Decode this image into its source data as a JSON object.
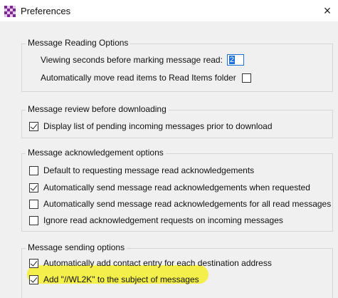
{
  "window": {
    "title": "Preferences",
    "close_glyph": "×"
  },
  "groups": [
    {
      "title": "Message Reading Options",
      "rows": [
        {
          "label": "Viewing seconds before marking message read:",
          "input_value": "2"
        },
        {
          "label": "Automatically move read items to Read Items folder",
          "checked": false
        }
      ]
    },
    {
      "title": "Message review before downloading",
      "rows": [
        {
          "label": "Display list of pending incoming messages prior to download",
          "checked": true
        }
      ]
    },
    {
      "title": "Message acknowledgement options",
      "rows": [
        {
          "label": "Default to requesting message read acknowledgements",
          "checked": false
        },
        {
          "label": "Automatically send message read acknowledgements when requested",
          "checked": true
        },
        {
          "label": "Automatically send message read acknowledgements for all read messages",
          "checked": false
        },
        {
          "label": "Ignore read acknowledgement requests on incoming messages",
          "checked": false
        }
      ]
    },
    {
      "title": "Message sending options",
      "rows": [
        {
          "label": "Automatically add contact entry for each destination address",
          "checked": true
        },
        {
          "label": "Add \"//WL2K\" to the subject of messages",
          "checked": true,
          "highlighted": true
        }
      ]
    }
  ],
  "colors": {
    "highlight": "#f4ee2d",
    "app_icon": "#7a2a8c"
  }
}
